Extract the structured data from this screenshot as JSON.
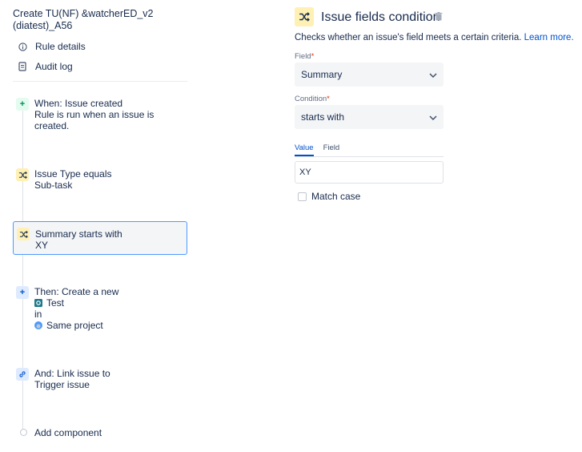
{
  "rule": {
    "title": "Create TU(NF) &watcherED_v2 (diatest)_A56"
  },
  "sidebar": {
    "nav": [
      {
        "label": "Rule details",
        "icon": "info-icon"
      },
      {
        "label": "Audit log",
        "icon": "clipboard-icon"
      }
    ]
  },
  "components": {
    "trigger": {
      "line1": "When: Issue created",
      "line2": "Rule is run when an issue is",
      "line3": "created."
    },
    "condition1": {
      "line1": "Issue Type equals",
      "line2": "Sub-task"
    },
    "condition2": {
      "line1": "Summary starts with",
      "line2": "XY"
    },
    "action1": {
      "line1": "Then: Create a new",
      "issue_type": "Test",
      "in": "in",
      "project": "Same project"
    },
    "action2": {
      "line1": "And: Link issue to",
      "line2": "Trigger issue"
    },
    "add_component": "Add component"
  },
  "panel": {
    "title": "Issue fields condition",
    "description": "Checks whether an issue's field meets a certain criteria.",
    "learn_more": "Learn more.",
    "field_label": "Field",
    "field_value": "Summary",
    "condition_label": "Condition",
    "condition_value": "starts with",
    "required_marker": "*",
    "tabs": [
      "Value",
      "Field"
    ],
    "value": "XY",
    "match_case_label": "Match case"
  },
  "colors": {
    "accent": "#0052cc",
    "selected_border": "#4c9aff",
    "condition_badge": "#fff0b3",
    "trigger_badge": "#e3fcef",
    "action_badge": "#deebff",
    "required": "#de350b"
  }
}
